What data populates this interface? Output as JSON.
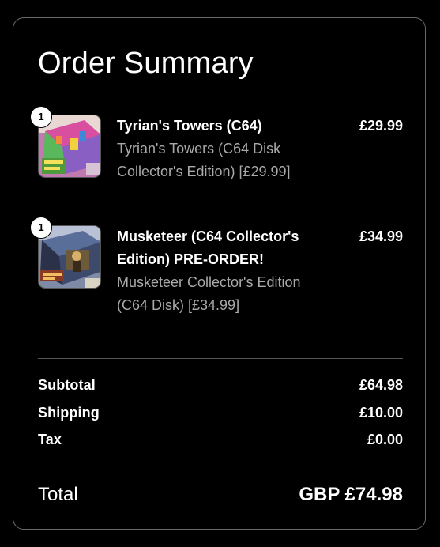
{
  "summary": {
    "title": "Order Summary"
  },
  "items": [
    {
      "quantity": "1",
      "name": "Tyrian's Towers (C64)",
      "description": "Tyrian's Towers (C64 Disk Collector's Edition) [£29.99]",
      "price": "£29.99",
      "thumbnail_icon": "game-box-tyrians-towers-thumbnail"
    },
    {
      "quantity": "1",
      "name": "Musketeer (C64 Collector's Edition) PRE-ORDER!",
      "description": "Musketeer Collector's Edition (C64 Disk) [£34.99]",
      "price": "£34.99",
      "thumbnail_icon": "game-box-musketeer-thumbnail"
    }
  ],
  "totals": {
    "subtotal_label": "Subtotal",
    "subtotal_value": "£64.98",
    "shipping_label": "Shipping",
    "shipping_value": "£10.00",
    "tax_label": "Tax",
    "tax_value": "£0.00",
    "total_label": "Total",
    "total_value": "GBP £74.98"
  },
  "colors": {
    "background": "#000000",
    "text": "#ffffff",
    "muted_text": "#a9a9a9",
    "border": "#6a6a6a",
    "badge_bg": "#ffffff"
  }
}
